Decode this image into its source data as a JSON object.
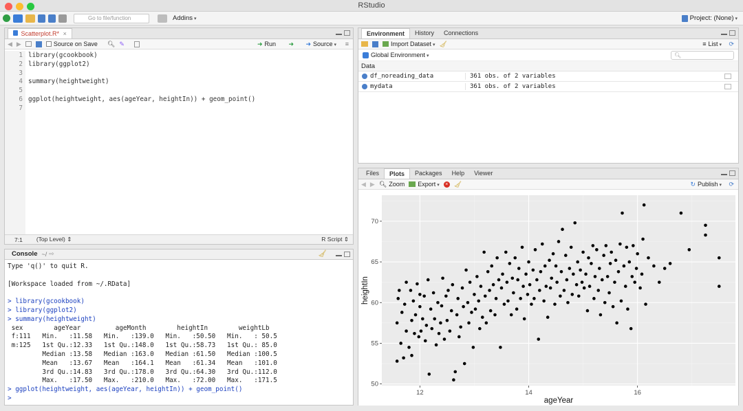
{
  "window": {
    "title": "RStudio"
  },
  "toolbar": {
    "goto_placeholder": "Go to file/function",
    "addins_label": "Addins",
    "project_label": "Project: (None)"
  },
  "editor": {
    "file_tab": "Scatterplot.R*",
    "source_on_save": "Source on Save",
    "run_label": "Run",
    "source_label": "Source",
    "lines": [
      "library(gcookbook)",
      "library(ggplot2)",
      "",
      "summary(heightweight)",
      "",
      "ggplot(heightweight, aes(ageYear, heightIn)) + geom_point()",
      ""
    ],
    "line_numbers": [
      "1",
      "2",
      "3",
      "4",
      "5",
      "6",
      "7"
    ],
    "status_position": "7:1",
    "status_scope": "(Top Level)",
    "status_filetype": "R Script"
  },
  "console": {
    "title": "Console",
    "path": "~/",
    "lines": [
      {
        "text": "Type 'q()' to quit R.",
        "kind": "output"
      },
      {
        "text": "",
        "kind": "output"
      },
      {
        "text": "[Workspace loaded from ~/.RData]",
        "kind": "output"
      },
      {
        "text": "",
        "kind": "output"
      },
      {
        "text": "> library(gcookbook)",
        "kind": "input"
      },
      {
        "text": "> library(ggplot2)",
        "kind": "input"
      },
      {
        "text": "> summary(heightweight)",
        "kind": "input"
      },
      {
        "text": " sex        ageYear         ageMonth        heightIn        weightLb    ",
        "kind": "output"
      },
      {
        "text": " f:111   Min.   :11.58   Min.   :139.0   Min.   :50.50   Min.   : 50.5  ",
        "kind": "output"
      },
      {
        "text": " m:125   1st Qu.:12.33   1st Qu.:148.0   1st Qu.:58.73   1st Qu.: 85.0  ",
        "kind": "output"
      },
      {
        "text": "         Median :13.58   Median :163.0   Median :61.50   Median :100.5  ",
        "kind": "output"
      },
      {
        "text": "         Mean   :13.67   Mean   :164.1   Mean   :61.34   Mean   :101.0  ",
        "kind": "output"
      },
      {
        "text": "         3rd Qu.:14.83   3rd Qu.:178.0   3rd Qu.:64.30   3rd Qu.:112.0  ",
        "kind": "output"
      },
      {
        "text": "         Max.   :17.50   Max.   :210.0   Max.   :72.00   Max.   :171.5  ",
        "kind": "output"
      },
      {
        "text": "> ggplot(heightweight, aes(ageYear, heightIn)) + geom_point()",
        "kind": "input"
      },
      {
        "text": "> ",
        "kind": "input"
      }
    ]
  },
  "environment": {
    "tabs": [
      "Environment",
      "History",
      "Connections"
    ],
    "import_label": "Import Dataset",
    "list_label": "List",
    "scope_label": "Global Environment",
    "section_label": "Data",
    "rows": [
      {
        "name": "df_noreading_data",
        "value": "361 obs. of 2 variables"
      },
      {
        "name": "mydata",
        "value": "361 obs. of 2 variables"
      }
    ]
  },
  "plots_pane": {
    "tabs": [
      "Files",
      "Plots",
      "Packages",
      "Help",
      "Viewer"
    ],
    "zoom_label": "Zoom",
    "export_label": "Export",
    "publish_label": "Publish"
  },
  "chart_data": {
    "type": "scatter",
    "title": "",
    "xlabel": "ageYear",
    "ylabel": "heightIn",
    "xlim": [
      11.3,
      17.8
    ],
    "ylim": [
      49.8,
      73.2
    ],
    "x_ticks": [
      12,
      14,
      16
    ],
    "y_ticks": [
      50,
      55,
      60,
      65,
      70
    ],
    "grid": true,
    "background": "#ebebeb",
    "points": [
      [
        11.58,
        52.8
      ],
      [
        11.58,
        57.5
      ],
      [
        11.6,
        60.5
      ],
      [
        11.62,
        61.5
      ],
      [
        11.65,
        55
      ],
      [
        11.67,
        58.8
      ],
      [
        11.7,
        53.2
      ],
      [
        11.72,
        59.8
      ],
      [
        11.75,
        56.5
      ],
      [
        11.75,
        62.5
      ],
      [
        11.8,
        54.5
      ],
      [
        11.83,
        61.5
      ],
      [
        11.85,
        53.5
      ],
      [
        11.85,
        57.8
      ],
      [
        11.88,
        60.2
      ],
      [
        11.9,
        56.2
      ],
      [
        11.92,
        58.5
      ],
      [
        11.95,
        62.3
      ],
      [
        11.98,
        55.8
      ],
      [
        12.0,
        59.5
      ],
      [
        12.0,
        61
      ],
      [
        12.02,
        56.5
      ],
      [
        12.05,
        58
      ],
      [
        12.08,
        60.8
      ],
      [
        12.1,
        55.3
      ],
      [
        12.12,
        57.2
      ],
      [
        12.15,
        62.8
      ],
      [
        12.17,
        51.2
      ],
      [
        12.2,
        59.2
      ],
      [
        12.22,
        56.8
      ],
      [
        12.25,
        61.2
      ],
      [
        12.27,
        58
      ],
      [
        12.3,
        54.8
      ],
      [
        12.33,
        60
      ],
      [
        12.35,
        56.2
      ],
      [
        12.38,
        57.5
      ],
      [
        12.4,
        59.6
      ],
      [
        12.42,
        63
      ],
      [
        12.45,
        55.5
      ],
      [
        12.48,
        60.8
      ],
      [
        12.5,
        57.8
      ],
      [
        12.52,
        61.5
      ],
      [
        12.55,
        56.5
      ],
      [
        12.58,
        59
      ],
      [
        12.6,
        62.2
      ],
      [
        12.62,
        50.5
      ],
      [
        12.65,
        51.5
      ],
      [
        12.68,
        58.5
      ],
      [
        12.7,
        60.5
      ],
      [
        12.72,
        55.8
      ],
      [
        12.75,
        57
      ],
      [
        12.78,
        61.8
      ],
      [
        12.8,
        59.5
      ],
      [
        12.82,
        52.5
      ],
      [
        12.85,
        64
      ],
      [
        12.88,
        60
      ],
      [
        12.9,
        57.5
      ],
      [
        12.92,
        62.5
      ],
      [
        12.95,
        58.8
      ],
      [
        12.98,
        54.5
      ],
      [
        13.0,
        61
      ],
      [
        13.02,
        59.2
      ],
      [
        13.05,
        63.2
      ],
      [
        13.08,
        60.2
      ],
      [
        13.1,
        56.8
      ],
      [
        13.12,
        62
      ],
      [
        13.15,
        58.2
      ],
      [
        13.18,
        66.2
      ],
      [
        13.2,
        60.8
      ],
      [
        13.22,
        57.5
      ],
      [
        13.25,
        63.8
      ],
      [
        13.28,
        61.5
      ],
      [
        13.3,
        59
      ],
      [
        13.32,
        64.5
      ],
      [
        13.35,
        62.2
      ],
      [
        13.38,
        58.5
      ],
      [
        13.4,
        60.5
      ],
      [
        13.42,
        65.5
      ],
      [
        13.45,
        62.8
      ],
      [
        13.48,
        54.5
      ],
      [
        13.5,
        61.8
      ],
      [
        13.52,
        63.5
      ],
      [
        13.55,
        59.8
      ],
      [
        13.58,
        66.2
      ],
      [
        13.6,
        62.5
      ],
      [
        13.62,
        60.2
      ],
      [
        13.65,
        64.8
      ],
      [
        13.68,
        58.5
      ],
      [
        13.7,
        63
      ],
      [
        13.72,
        61.2
      ],
      [
        13.75,
        65.5
      ],
      [
        13.78,
        59.2
      ],
      [
        13.8,
        62.8
      ],
      [
        13.82,
        64.2
      ],
      [
        13.85,
        60.5
      ],
      [
        13.88,
        66.8
      ],
      [
        13.9,
        62
      ],
      [
        13.92,
        58
      ],
      [
        13.95,
        63.5
      ],
      [
        13.98,
        61
      ],
      [
        14.0,
        65
      ],
      [
        14.02,
        62.2
      ],
      [
        14.05,
        59.8
      ],
      [
        14.08,
        64
      ],
      [
        14.1,
        60.5
      ],
      [
        14.12,
        66.5
      ],
      [
        14.15,
        62.8
      ],
      [
        14.18,
        55.5
      ],
      [
        14.2,
        61.5
      ],
      [
        14.22,
        63.8
      ],
      [
        14.25,
        67.2
      ],
      [
        14.28,
        60.2
      ],
      [
        14.3,
        64.5
      ],
      [
        14.32,
        62
      ],
      [
        14.35,
        58.2
      ],
      [
        14.38,
        65.2
      ],
      [
        14.4,
        61.8
      ],
      [
        14.42,
        63
      ],
      [
        14.45,
        66
      ],
      [
        14.48,
        59.8
      ],
      [
        14.5,
        64.5
      ],
      [
        14.52,
        62.5
      ],
      [
        14.55,
        67.5
      ],
      [
        14.58,
        60.8
      ],
      [
        14.6,
        63.8
      ],
      [
        14.62,
        69
      ],
      [
        14.65,
        61.5
      ],
      [
        14.68,
        65.8
      ],
      [
        14.7,
        62.8
      ],
      [
        14.72,
        60
      ],
      [
        14.75,
        64.2
      ],
      [
        14.78,
        66.8
      ],
      [
        14.8,
        61
      ],
      [
        14.82,
        63.5
      ],
      [
        14.85,
        69.8
      ],
      [
        14.88,
        62.2
      ],
      [
        14.9,
        65
      ],
      [
        14.92,
        60.8
      ],
      [
        14.95,
        64
      ],
      [
        14.98,
        62.5
      ],
      [
        15.0,
        66.2
      ],
      [
        15.02,
        61.8
      ],
      [
        15.05,
        63.5
      ],
      [
        15.08,
        59
      ],
      [
        15.1,
        65.5
      ],
      [
        15.12,
        62
      ],
      [
        15.15,
        64.8
      ],
      [
        15.18,
        67
      ],
      [
        15.2,
        60.5
      ],
      [
        15.22,
        63.2
      ],
      [
        15.25,
        66.5
      ],
      [
        15.28,
        61.5
      ],
      [
        15.3,
        64.2
      ],
      [
        15.32,
        58.5
      ],
      [
        15.35,
        62.8
      ],
      [
        15.38,
        65.8
      ],
      [
        15.4,
        60
      ],
      [
        15.42,
        67
      ],
      [
        15.45,
        63.2
      ],
      [
        15.48,
        61.2
      ],
      [
        15.5,
        64.8
      ],
      [
        15.52,
        66.2
      ],
      [
        15.55,
        59.5
      ],
      [
        15.58,
        62.5
      ],
      [
        15.6,
        65.2
      ],
      [
        15.62,
        57.5
      ],
      [
        15.65,
        63.8
      ],
      [
        15.68,
        67.2
      ],
      [
        15.7,
        60.2
      ],
      [
        15.72,
        71
      ],
      [
        15.75,
        64.5
      ],
      [
        15.78,
        62
      ],
      [
        15.8,
        66.8
      ],
      [
        15.82,
        59.2
      ],
      [
        15.85,
        65
      ],
      [
        15.88,
        56.8
      ],
      [
        15.9,
        63.2
      ],
      [
        15.92,
        67
      ],
      [
        15.95,
        62.5
      ],
      [
        15.98,
        64.2
      ],
      [
        16.0,
        66
      ],
      [
        16.05,
        61.8
      ],
      [
        16.08,
        63.5
      ],
      [
        16.1,
        67.8
      ],
      [
        16.12,
        72
      ],
      [
        16.15,
        59.8
      ],
      [
        16.2,
        65.5
      ],
      [
        16.3,
        64.5
      ],
      [
        16.4,
        62.5
      ],
      [
        16.5,
        64.2
      ],
      [
        16.6,
        64.8
      ],
      [
        16.8,
        71
      ],
      [
        16.95,
        66.5
      ],
      [
        17.25,
        69.5
      ],
      [
        17.25,
        68.3
      ],
      [
        17.5,
        65.5
      ],
      [
        17.5,
        62
      ]
    ]
  }
}
